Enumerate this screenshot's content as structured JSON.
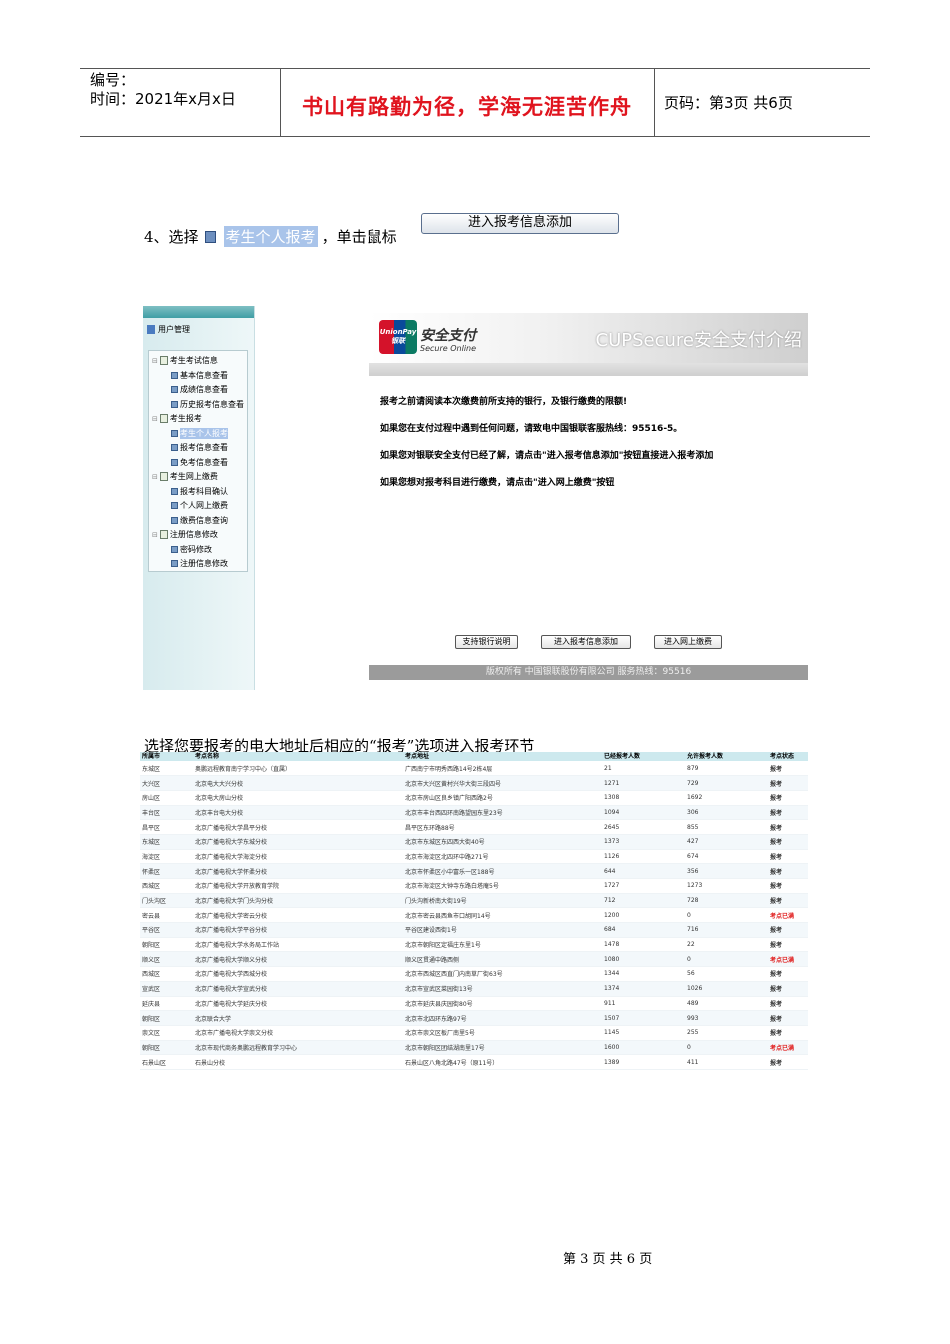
{
  "header": {
    "number_label": "编号：",
    "date": "时间：2021年x月x日",
    "motto": "书山有路勤为径，学海无涯苦作舟",
    "page_info": "页码：第3页  共6页"
  },
  "step": {
    "prefix": "4、选择",
    "highlighted_item": "考生个人报考",
    "suffix": "，单击鼠标",
    "button": "进入报考信息添加"
  },
  "sidebar": {
    "title": "用户管理",
    "groups": [
      {
        "label": "考生考试信息",
        "items": [
          "基本信息查看",
          "成绩信息查看",
          "历史报考信息查看"
        ]
      },
      {
        "label": "考生报考",
        "items": [
          "考生个人报考",
          "报考信息查看",
          "免考信息查看"
        ]
      },
      {
        "label": "考生网上缴费",
        "items": [
          "报考科目确认",
          "个人网上缴费",
          "缴费信息查询"
        ]
      },
      {
        "label": "注册信息修改",
        "items": [
          "密码修改",
          "注册信息修改"
        ]
      }
    ],
    "selected": "考生个人报考"
  },
  "cup": {
    "logo_top": "UnionPay",
    "logo_bottom": "银联",
    "brand": "安全支付",
    "brand_en": "Secure Online",
    "title": "CUPSecure安全支付介绍",
    "lines": [
      "报考之前请阅读本次缴费前所支持的银行，及银行缴费的限额!",
      " 如果您在支付过程中遇到任何问题，请致电中国银联客服热线：95516-5。",
      "如果您对银联安全支付已经了解，请点击\"进入报考信息添加\"按钮直接进入报考添加",
      "如果您想对报考科目进行缴费，请点击\"进入网上缴费\"按钮"
    ],
    "buttons": [
      "支持银行说明",
      "进入报考信息添加",
      "进入网上缴费"
    ],
    "footer": "版权所有  中国银联股份有限公司     服务热线：95516"
  },
  "caption": "选择您要报考的电大地址后相应的“报考”选项进入报考环节",
  "table": {
    "headers": [
      "所属市",
      "考点名称",
      "考点地址",
      "已经报考人数",
      "允许报考人数",
      "考点状态"
    ],
    "rows": [
      [
        "东城区",
        "奥鹏远程教育南宁学习中心（直属）",
        "广西南宁市明秀西路14号2栋4层",
        "21",
        "879",
        "报考"
      ],
      [
        "大兴区",
        "北京电大大兴分校",
        "北京市大兴区黄村兴华大街三段四号",
        "1271",
        "729",
        "报考"
      ],
      [
        "房山区",
        "北京电大房山分校",
        "北京市房山区良乡镇广阳西路2号",
        "1308",
        "1692",
        "报考"
      ],
      [
        "丰台区",
        "北京丰台电大分校",
        "北京市丰台西四环南路望园东里23号",
        "1094",
        "306",
        "报考"
      ],
      [
        "昌平区",
        "北京广播电视大学昌平分校",
        "昌平区东环路88号",
        "2645",
        "855",
        "报考"
      ],
      [
        "东城区",
        "北京广播电视大学东城分校",
        "北京市东城区东四西大街40号",
        "1373",
        "427",
        "报考"
      ],
      [
        "海淀区",
        "北京广播电视大学海淀分校",
        "北京市海淀区北四环中路271号",
        "1126",
        "674",
        "报考"
      ],
      [
        "怀柔区",
        "北京广播电视大学怀柔分校",
        "北京市怀柔区小中富乐一区188号",
        "644",
        "356",
        "报考"
      ],
      [
        "西城区",
        "北京广播电视大学开放教育学院",
        "北京市海淀区大钟寺东路白塔庵5号",
        "1727",
        "1273",
        "报考"
      ],
      [
        "门头沟区",
        "北京广播电视大学门头沟分校",
        "门头沟新桥南大街19号",
        "712",
        "728",
        "报考"
      ],
      [
        "密云县",
        "北京广播电视大学密云分校",
        "北京市密云县西鱼市口胡同14号",
        "1200",
        "0",
        "考点已满"
      ],
      [
        "平谷区",
        "北京广播电视大学平谷分校",
        "平谷区建设西街1号",
        "684",
        "716",
        "报考"
      ],
      [
        "朝阳区",
        "北京广播电视大学水务局工作站",
        "北京市朝阳区定福庄东里1号",
        "1478",
        "22",
        "报考"
      ],
      [
        "顺义区",
        "北京广播电视大学顺义分校",
        "顺义区贯通中路西侧",
        "1080",
        "0",
        "考点已满"
      ],
      [
        "西城区",
        "北京广播电视大学西城分校",
        "北京市西城区西直门内南草厂街63号",
        "1344",
        "56",
        "报考"
      ],
      [
        "宣武区",
        "北京广播电视大学宣武分校",
        "北京市宣武区菜园街13号",
        "1374",
        "1026",
        "报考"
      ],
      [
        "延庆县",
        "北京广播电视大学延庆分校",
        "北京市延庆县庆园街80号",
        "911",
        "489",
        "报考"
      ],
      [
        "朝阳区",
        "北京联合大学",
        "北京市北四环东路97号",
        "1507",
        "993",
        "报考"
      ],
      [
        "崇文区",
        "北京市广播电视大学崇文分校",
        "北京市崇文区板厂南里5号",
        "1145",
        "255",
        "报考"
      ],
      [
        "朝阳区",
        "北京市现代商务奥鹏远程教育学习中心",
        "北京市朝阳区团结湖南里17号",
        "1600",
        "0",
        "考点已满"
      ],
      [
        "石景山区",
        "石景山分校",
        "石景山区八角北路47号（原11号）",
        "1389",
        "411",
        "报考"
      ]
    ]
  },
  "footer": "第 3 页 共 6 页"
}
